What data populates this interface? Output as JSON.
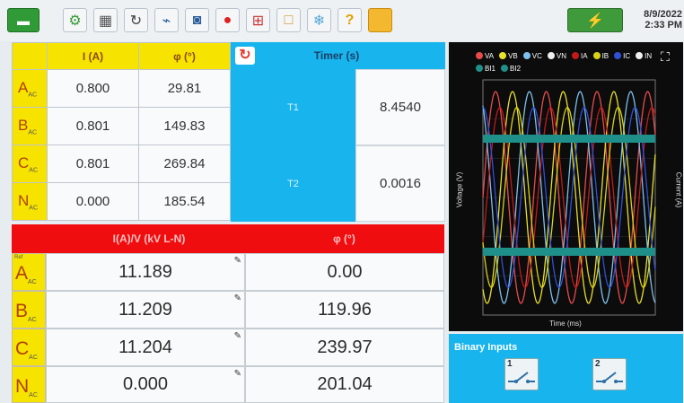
{
  "header": {
    "date": "8/9/2022",
    "time": "2:33 PM"
  },
  "toolbar": {
    "icons": [
      "home-icon",
      "gear-icon",
      "calculator-icon",
      "rotate-icon",
      "line-icon",
      "camera-icon",
      "record-icon",
      "grid-icon",
      "square-icon",
      "snowflake-icon",
      "help-icon",
      "folder-icon",
      "status-icon"
    ]
  },
  "current_table": {
    "headers": [
      "I (A)",
      "φ (°)"
    ],
    "rows": [
      {
        "phase": "A",
        "sub": "AC",
        "i": "0.800",
        "phi": "29.81"
      },
      {
        "phase": "B",
        "sub": "AC",
        "i": "0.801",
        "phi": "149.83"
      },
      {
        "phase": "C",
        "sub": "AC",
        "i": "0.801",
        "phi": "269.84"
      },
      {
        "phase": "N",
        "sub": "AC",
        "i": "0.000",
        "phi": "185.54"
      }
    ]
  },
  "timer": {
    "title": "Timer (s)",
    "t1_label": "T1",
    "t1_value": "8.4540",
    "t2_label": "T2",
    "t2_value": "0.0016"
  },
  "voltage_table": {
    "headers": [
      "I(A)/V (kV L-N)",
      "φ (°)"
    ],
    "ref_label": "Ref",
    "rows": [
      {
        "phase": "A",
        "sub": "AC",
        "v": "11.189",
        "phi": "0.00"
      },
      {
        "phase": "B",
        "sub": "AC",
        "v": "11.209",
        "phi": "119.96"
      },
      {
        "phase": "C",
        "sub": "AC",
        "v": "11.204",
        "phi": "239.97"
      },
      {
        "phase": "N",
        "sub": "AC",
        "v": "0.000",
        "phi": "201.04"
      }
    ]
  },
  "scope": {
    "legend": [
      "VA",
      "VB",
      "VC",
      "VN",
      "IA",
      "IB",
      "IC",
      "IN",
      "BI1",
      "BI2"
    ],
    "colors": {
      "VA": "#e84b4b",
      "VB": "#e8e02a",
      "VC": "#7ec0ee",
      "VN": "#eeeeee",
      "IA": "#c01a1a",
      "IB": "#d9d316",
      "IC": "#3050d8",
      "IN": "#f0f0f0",
      "BI1": "#1f8f8a",
      "BI2": "#1f8f8a"
    },
    "ylabel": "Voltage (V)",
    "y2label": "Current (A)",
    "xlabel": "Time (ms)"
  },
  "binary": {
    "title": "Binary Inputs",
    "inputs": [
      "1",
      "2"
    ]
  }
}
